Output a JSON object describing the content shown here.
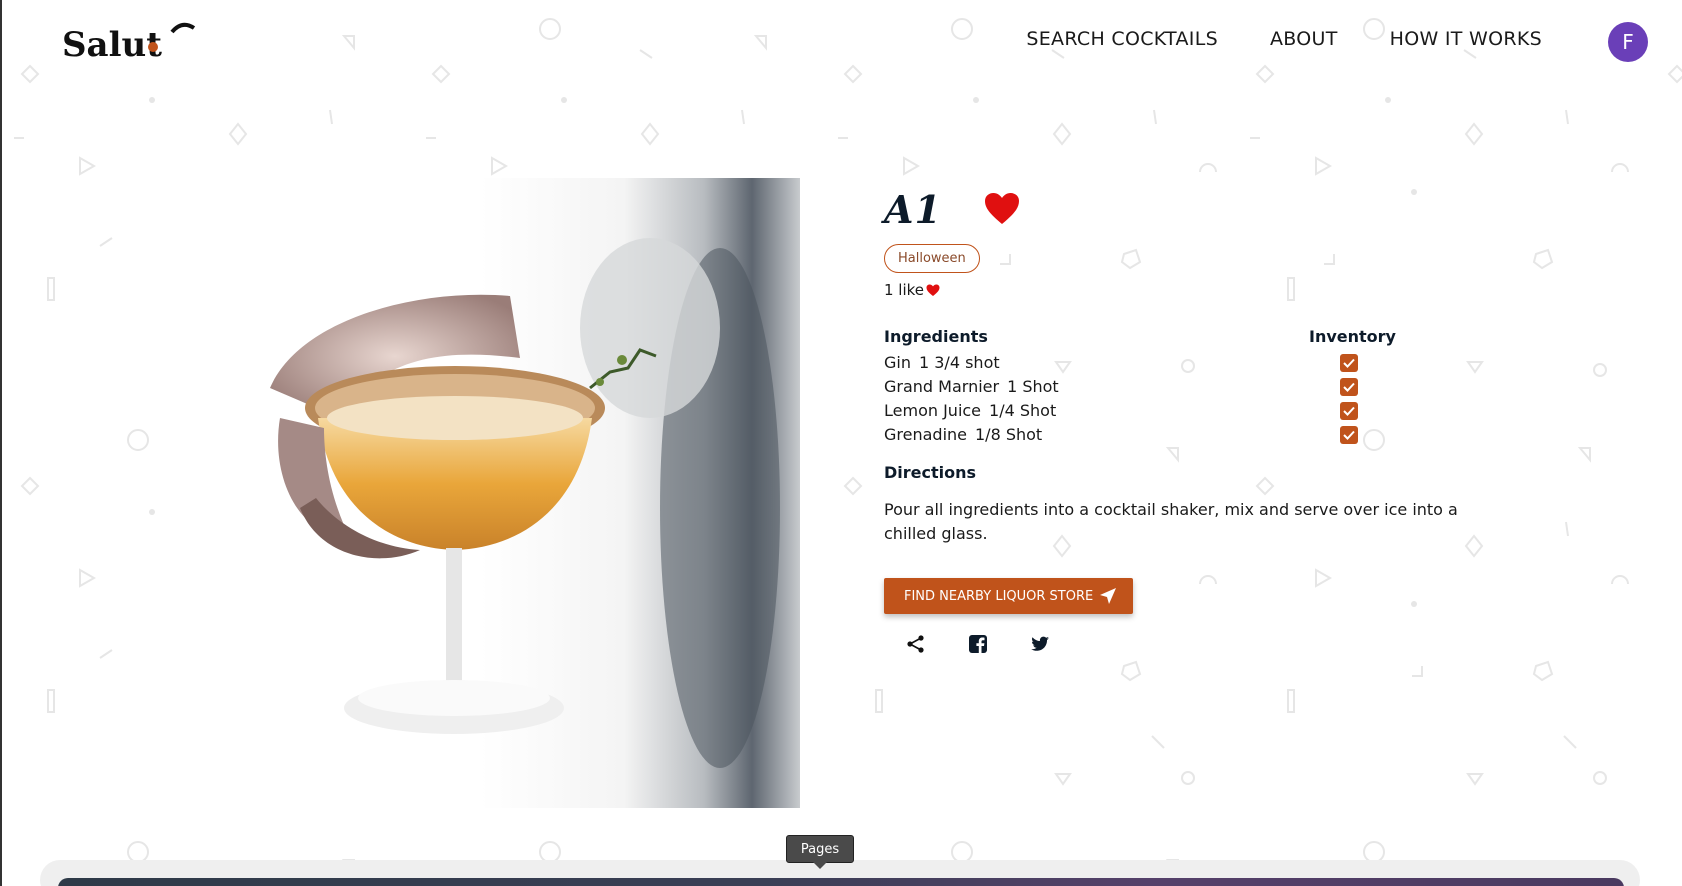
{
  "header": {
    "logo_text": "Salut",
    "nav": [
      {
        "label": "SEARCH COCKTAILS"
      },
      {
        "label": "ABOUT"
      },
      {
        "label": "HOW IT WORKS"
      }
    ],
    "avatar_initial": "F"
  },
  "cocktail": {
    "name": "A1",
    "tag": "Halloween",
    "likes_text": "1 like",
    "ingredients_heading": "Ingredients",
    "inventory_heading": "Inventory",
    "ingredients": [
      {
        "name": "Gin",
        "qty": "1 3/4 shot",
        "in_inventory": true
      },
      {
        "name": "Grand Marnier",
        "qty": "1 Shot",
        "in_inventory": true
      },
      {
        "name": "Lemon Juice",
        "qty": "1/4 Shot",
        "in_inventory": true
      },
      {
        "name": "Grenadine",
        "qty": "1/8 Shot",
        "in_inventory": true
      }
    ],
    "directions_heading": "Directions",
    "directions": "Pour all ingredients into a cocktail shaker, mix and serve over ice into a chilled glass."
  },
  "actions": {
    "find_store_label": "FIND NEARBY LIQUOR STORE"
  },
  "share": {
    "icons": [
      "share-icon",
      "facebook-icon",
      "twitter-icon"
    ]
  },
  "dock": {
    "tooltip": "Pages"
  },
  "colors": {
    "accent": "#c0531b",
    "heart": "#e01010",
    "avatar": "#6a3fb8",
    "navy": "#0d1b2a"
  }
}
